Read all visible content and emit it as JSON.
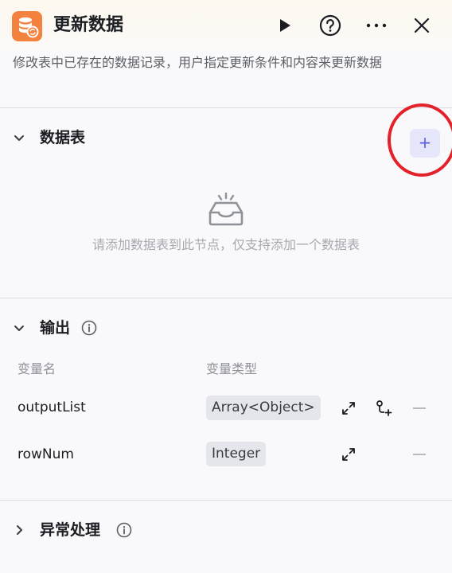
{
  "header": {
    "title": "更新数据",
    "icons": [
      "database-sync-icon",
      "run-icon",
      "help-icon",
      "more-icon",
      "close-icon"
    ]
  },
  "description": "修改表中已存在的数据记录，用户指定更新条件和内容来更新数据",
  "data_table_section": {
    "title": "数据表",
    "add_label": "+",
    "empty_text": "请添加数据表到此节点，仅支持添加一个数据表"
  },
  "output_section": {
    "title": "输出",
    "columns": {
      "name": "变量名",
      "type": "变量类型"
    },
    "rows": [
      {
        "name": "outputList",
        "type": "Array<Object>"
      },
      {
        "name": "rowNum",
        "type": "Integer"
      }
    ]
  },
  "exception_section": {
    "title": "异常处理"
  },
  "colors": {
    "accent": "#5a5fe0",
    "icon_orange": "#f4823f",
    "highlight_circle": "#e4212b"
  }
}
